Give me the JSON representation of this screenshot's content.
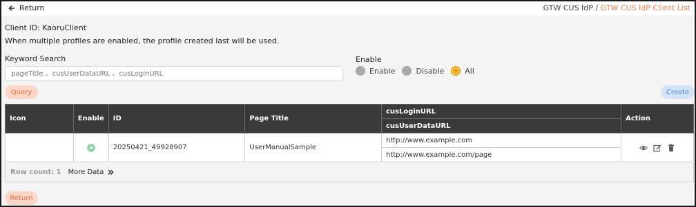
{
  "nav": {
    "return_label": "Return",
    "breadcrumb_parent": "GTW CUS IdP",
    "breadcrumb_sep": " / ",
    "breadcrumb_current": "GTW CUS IdP Client List"
  },
  "info": {
    "client_id": "Client ID: KaoruClient",
    "note": "When multiple profiles are enabled, the profile created last will be used."
  },
  "search": {
    "label": "Keyword Search",
    "placeholder": "pageTitle 、cusUserDataURL 、cusLoginURL",
    "value": ""
  },
  "enable_filter": {
    "label": "Enable",
    "options": [
      "Enable",
      "Disable",
      "All"
    ],
    "selected": "All"
  },
  "buttons": {
    "query": "Query",
    "create": "Create",
    "return": "Return"
  },
  "table": {
    "headers": {
      "icon": "Icon",
      "enable": "Enable",
      "id": "ID",
      "page_title": "Page Title",
      "cus_login_url": "cusLoginURL",
      "cus_user_data_url": "cusUserDataURL",
      "action": "Action"
    },
    "rows": [
      {
        "icon": "",
        "enabled": true,
        "id": "20250421_49928907",
        "page_title": "UserManualSample",
        "cus_login_url": "http://www.example.com",
        "cus_user_data_url": "http://www.example.com/page"
      }
    ],
    "row_count_label": "Row count: 1",
    "more_data_label": "More Data"
  },
  "colors": {
    "accent": "#f07d4a",
    "enabled_status": "#8bd4a2",
    "radio_selected": "#f2a100",
    "create": "#4a86d6"
  }
}
